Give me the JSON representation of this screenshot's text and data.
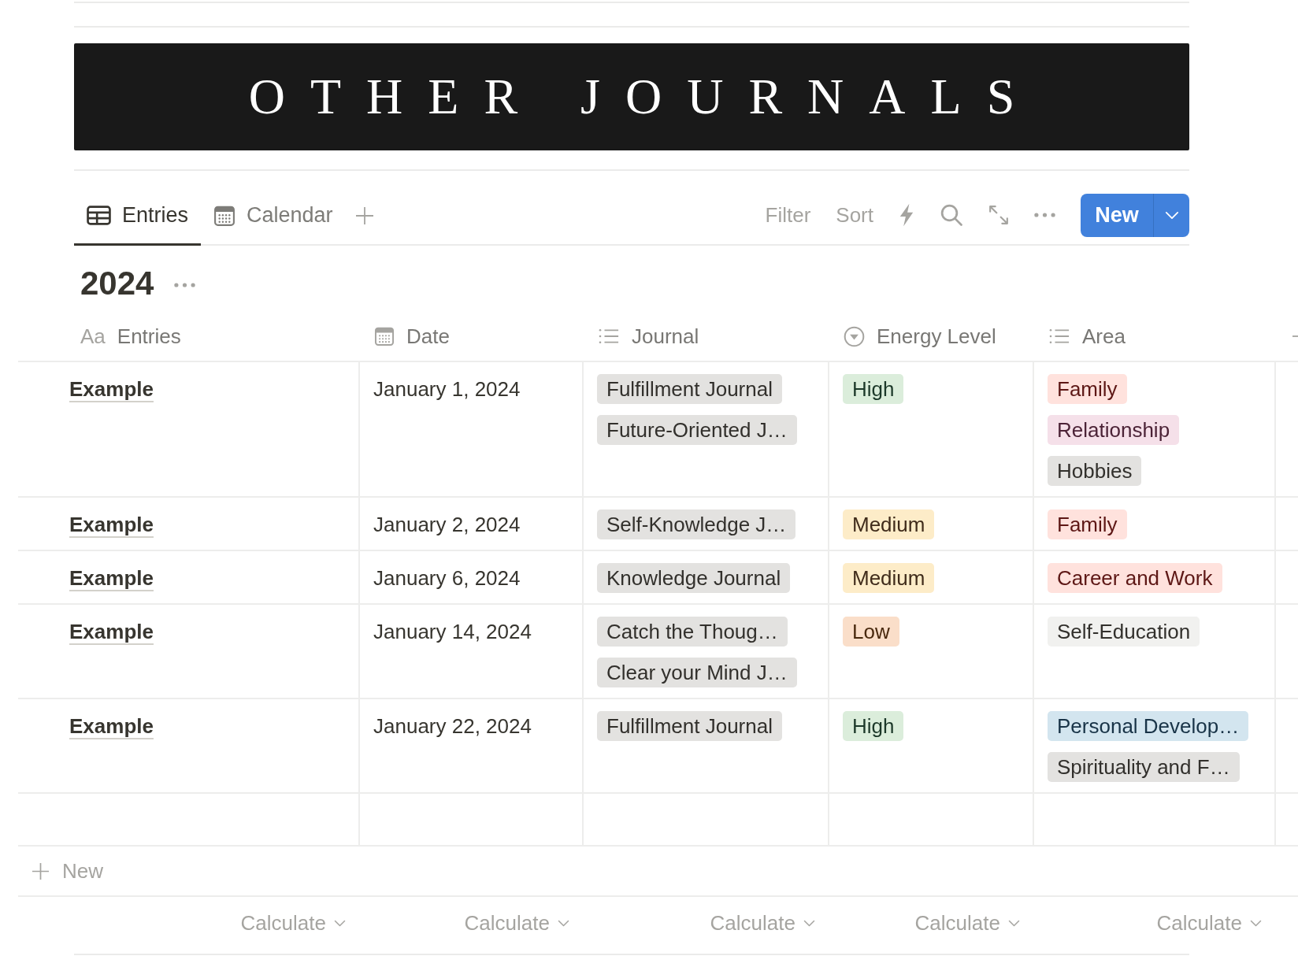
{
  "banner": {
    "title": "OTHER JOURNALS"
  },
  "tabs": [
    {
      "kind": "table",
      "label": "Entries",
      "selected": true
    },
    {
      "kind": "calendar",
      "label": "Calendar",
      "selected": false
    }
  ],
  "toolbar": {
    "filter": "Filter",
    "sort": "Sort",
    "new_button": "New"
  },
  "view": {
    "title": "2024"
  },
  "table": {
    "columns": [
      {
        "kind": "title",
        "icon_text": "Aa",
        "label": "Entries"
      },
      {
        "kind": "date",
        "label": "Date"
      },
      {
        "kind": "multi_select",
        "label": "Journal"
      },
      {
        "kind": "select",
        "label": "Energy Level"
      },
      {
        "kind": "multi_select",
        "label": "Area"
      }
    ],
    "rows": [
      {
        "cells": [
          {
            "kind": "title",
            "text": "Example"
          },
          {
            "kind": "date",
            "text": "January 1, 2024"
          },
          {
            "kind": "tags",
            "tags": [
              {
                "label": "Fulfillment Journal",
                "color": "#e3e2e0"
              },
              {
                "label": "Future-Oriented J…",
                "color": "#e3e2e0"
              }
            ]
          },
          {
            "kind": "tags",
            "tags": [
              {
                "label": "High",
                "color": "#dbeddb"
              }
            ]
          },
          {
            "kind": "tags",
            "tags": [
              {
                "label": "Family",
                "color": "#ffe2dd"
              },
              {
                "label": "Relationship",
                "color": "#f5e0e9"
              },
              {
                "label": "Hobbies",
                "color": "#e3e2e0"
              }
            ]
          }
        ]
      },
      {
        "cells": [
          {
            "kind": "title",
            "text": "Example"
          },
          {
            "kind": "date",
            "text": "January 2, 2024"
          },
          {
            "kind": "tags",
            "tags": [
              {
                "label": "Self-Knowledge J…",
                "color": "#e3e2e0"
              }
            ]
          },
          {
            "kind": "tags",
            "tags": [
              {
                "label": "Medium",
                "color": "#fdecc8"
              }
            ]
          },
          {
            "kind": "tags",
            "tags": [
              {
                "label": "Family",
                "color": "#ffe2dd"
              }
            ]
          }
        ]
      },
      {
        "cells": [
          {
            "kind": "title",
            "text": "Example"
          },
          {
            "kind": "date",
            "text": "January 6, 2024"
          },
          {
            "kind": "tags",
            "tags": [
              {
                "label": "Knowledge Journal",
                "color": "#e3e2e0"
              }
            ]
          },
          {
            "kind": "tags",
            "tags": [
              {
                "label": "Medium",
                "color": "#fdecc8"
              }
            ]
          },
          {
            "kind": "tags",
            "tags": [
              {
                "label": "Career and Work",
                "color": "#ffe2dd"
              }
            ]
          }
        ]
      },
      {
        "cells": [
          {
            "kind": "title",
            "text": "Example"
          },
          {
            "kind": "date",
            "text": "January 14, 2024"
          },
          {
            "kind": "tags",
            "tags": [
              {
                "label": "Catch the Thoug…",
                "color": "#e3e2e0"
              },
              {
                "label": "Clear your Mind J…",
                "color": "#e3e2e0"
              }
            ]
          },
          {
            "kind": "tags",
            "tags": [
              {
                "label": "Low",
                "color": "#fadec9"
              }
            ]
          },
          {
            "kind": "tags",
            "tags": [
              {
                "label": "Self-Education",
                "color": "#f1f1ef"
              }
            ]
          }
        ]
      },
      {
        "cells": [
          {
            "kind": "title",
            "text": "Example"
          },
          {
            "kind": "date",
            "text": "January 22, 2024"
          },
          {
            "kind": "tags",
            "tags": [
              {
                "label": "Fulfillment Journal",
                "color": "#e3e2e0"
              }
            ]
          },
          {
            "kind": "tags",
            "tags": [
              {
                "label": "High",
                "color": "#dbeddb"
              }
            ]
          },
          {
            "kind": "tags",
            "tags": [
              {
                "label": "Personal Develop…",
                "color": "#d3e5ef"
              },
              {
                "label": "Spirituality and F…",
                "color": "#e3e2e0"
              }
            ]
          }
        ]
      }
    ],
    "new_row": "New",
    "calculations": [
      "Calculate",
      "Calculate",
      "Calculate",
      "Calculate",
      "Calculate"
    ]
  }
}
